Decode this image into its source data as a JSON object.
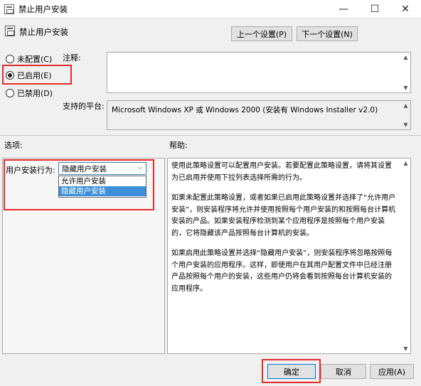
{
  "window": {
    "title": "禁止用户安装",
    "controls": {
      "minimize": "—",
      "maximize": "☐",
      "close": "✕"
    }
  },
  "header": {
    "title": "禁止用户安装",
    "prev_button": "上一个设置(P)",
    "next_button": "下一个设置(N)"
  },
  "state": {
    "options": [
      {
        "label": "未配置(C)",
        "checked": false
      },
      {
        "label": "已启用(E)",
        "checked": true
      },
      {
        "label": "已禁用(D)",
        "checked": false
      }
    ]
  },
  "comment": {
    "label": "注释:",
    "value": ""
  },
  "platform": {
    "label": "支持的平台:",
    "value": "Microsoft Windows XP 或 Windows 2000 (安装有 Windows Installer v2.0)"
  },
  "options_section": {
    "label": "选项:",
    "field_label": "用户安装行为:",
    "selected": "隐藏用户安装",
    "dropdown_items": [
      "允许用户安装",
      "隐藏用户安装"
    ],
    "highlighted_index": 1
  },
  "help_section": {
    "label": "帮助:",
    "paragraphs": [
      "使用此策略设置可以配置用户安装。若要配置此策略设置，请将其设置为已启用并使用下拉列表选择所需的行为。",
      "如果未配置此策略设置，或者如果已启用此策略设置并选择了“允许用户安装”，则安装程序将允许并使用按照每个用户安装的和按照每台计算机安装的产品。如果安装程序检测到某个应用程序是按照每个用户安装的，它将隐藏该产品按照每台计算机的安装。",
      "如果启用此策略设置并选择“隐藏用户安装”，则安装程序将忽略按照每个用户安装的应用程序。这样，即使用户在其用户配置文件中已经注册产品按照每个用户的安装，这些用户仍将会看到按照每台计算机安装的应用程序。"
    ]
  },
  "footer": {
    "ok": "确定",
    "cancel": "取消",
    "apply": "应用(A)"
  },
  "colors": {
    "highlight_box": "#e32b2b",
    "selection": "#3b8fd9",
    "dialog_bg": "#f0f0f0"
  }
}
